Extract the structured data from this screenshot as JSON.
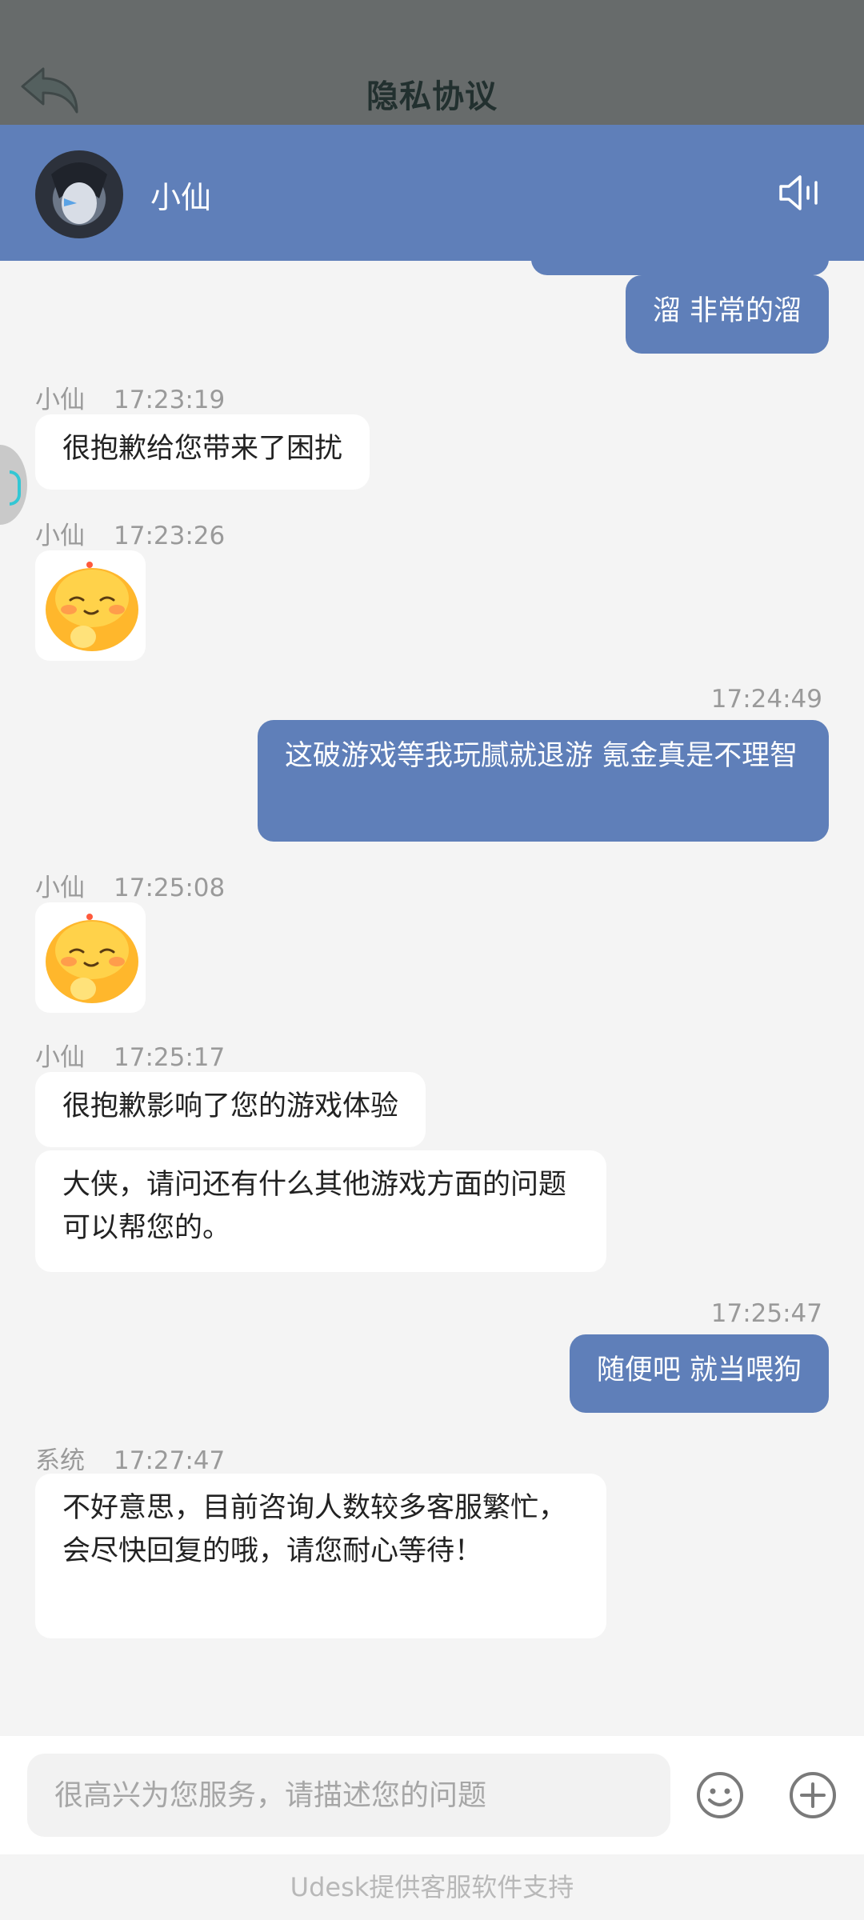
{
  "topbar": {
    "title": "隐私协议"
  },
  "header": {
    "agent_name": "小仙"
  },
  "messages": {
    "m1": {
      "text": "溜 非常的溜"
    },
    "m2": {
      "sender": "小仙",
      "time": "17:23:19",
      "text": "很抱歉给您带来了困扰"
    },
    "m3": {
      "sender": "小仙",
      "time": "17:23:26"
    },
    "m4": {
      "time": "17:24:49",
      "text": "这破游戏等我玩腻就退游 氪金真是不理智"
    },
    "m5": {
      "sender": "小仙",
      "time": "17:25:08"
    },
    "m6": {
      "sender": "小仙",
      "time": "17:25:17",
      "text1": "很抱歉影响了您的游戏体验",
      "text2": "大侠，请问还有什么其他游戏方面的问题可以帮您的。"
    },
    "m7": {
      "time": "17:25:47",
      "text": "随便吧 就当喂狗"
    },
    "m8": {
      "sender": "系统",
      "time": "17:27:47",
      "text": "不好意思，目前咨询人数较多客服繁忙，会尽快回复的哦，请您耐心等待！"
    }
  },
  "input": {
    "placeholder": "很高兴为您服务，请描述您的问题"
  },
  "footer": {
    "text": "Udesk提供客服软件支持"
  },
  "colors": {
    "accent": "#5f7fb9",
    "overlay": "#676b6b"
  },
  "icons": [
    "back-arrow-icon",
    "speaker-icon",
    "emoji-icon",
    "plus-icon",
    "emoji-sticker-icon"
  ]
}
